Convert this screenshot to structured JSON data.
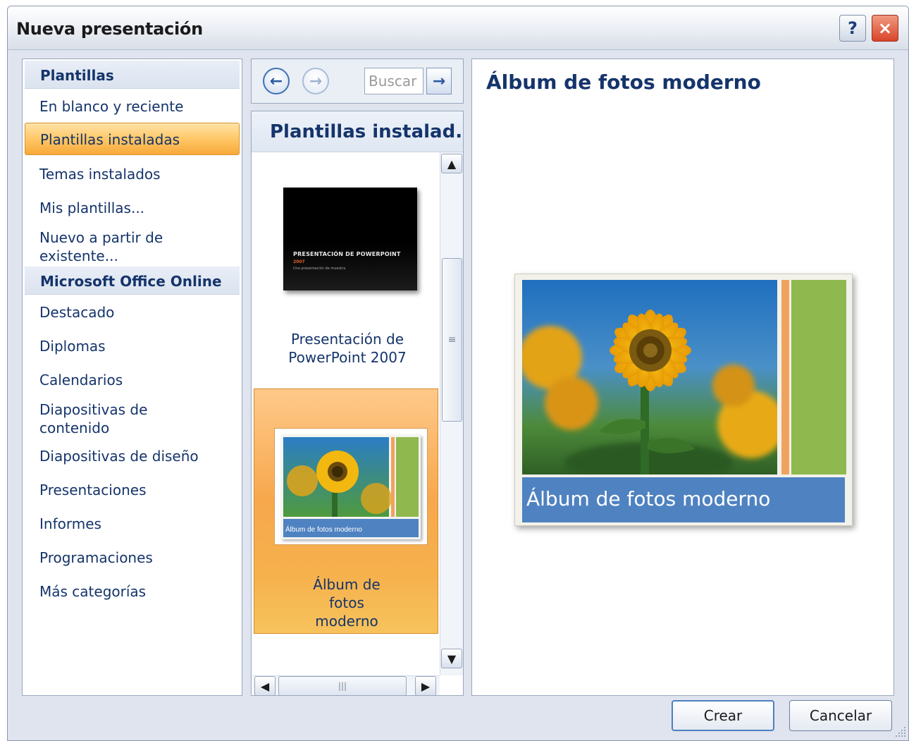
{
  "window": {
    "title": "Nueva presentación",
    "help_icon": "?",
    "close_icon": "×"
  },
  "left_nav": {
    "header_templates": "Plantillas",
    "items_templates": [
      "En blanco y reciente",
      "Plantillas instaladas",
      "Temas instalados",
      "Mis plantillas...",
      "Nuevo a partir de existente..."
    ],
    "selected_item": "Plantillas instaladas",
    "header_online": "Microsoft Office Online",
    "items_online": [
      "Destacado",
      "Diplomas",
      "Calendarios",
      "Diapositivas de contenido",
      "Diapositivas de diseño",
      "Presentaciones",
      "Informes",
      "Programaciones",
      "Más categorías"
    ]
  },
  "toolbar": {
    "search_placeholder": "Buscar"
  },
  "template_list": {
    "header": "Plantillas instalad...",
    "items": [
      {
        "caption": "Presentación de PowerPoint 2007",
        "thumb_title": "PRESENTACIÓN DE POWERPOINT",
        "thumb_sub1": "2007",
        "thumb_sub2": "Una presentación de muestra"
      },
      {
        "caption": "Álbum de fotos moderno",
        "thumb_band_text": "Álbum de fotos moderno",
        "selected": true
      }
    ]
  },
  "preview": {
    "title": "Álbum de fotos moderno",
    "band_text": "Álbum de fotos moderno"
  },
  "buttons": {
    "create": "Crear",
    "cancel": "Cancelar"
  },
  "colors": {
    "nav_text": "#15346b",
    "selection_orange": "#f7a93a",
    "album_blue": "#4f82c1",
    "album_green": "#8fb84f",
    "album_orange": "#f0a35e"
  }
}
